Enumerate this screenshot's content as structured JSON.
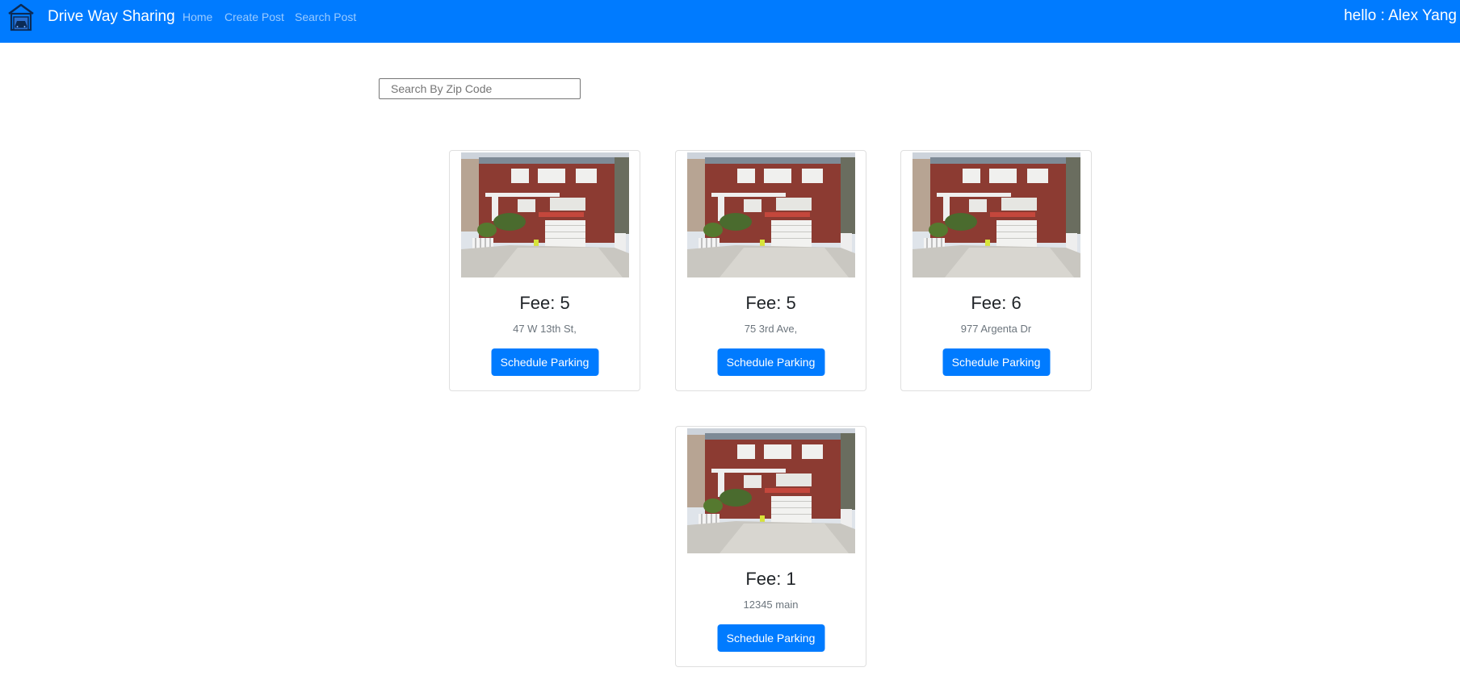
{
  "brand": {
    "title": "Drive Way Sharing",
    "logo_icon": "garage-house-icon"
  },
  "nav": {
    "home": "Home",
    "create_post": "Create Post",
    "search_post": "Search Post"
  },
  "user": {
    "greeting": "hello : Alex Yang"
  },
  "search": {
    "placeholder": "Search By Zip Code",
    "value": ""
  },
  "colors": {
    "primary": "#007bff",
    "navbar": "#007bff",
    "muted_text": "#6c757d"
  },
  "posts": [
    {
      "fee": "Fee: 5",
      "address": "47 W 13th St,",
      "button": "Schedule Parking"
    },
    {
      "fee": "Fee: 5",
      "address": "75 3rd Ave,",
      "button": "Schedule Parking"
    },
    {
      "fee": "Fee: 6",
      "address": "977 Argenta Dr",
      "button": "Schedule Parking"
    },
    {
      "fee": "Fee: 1",
      "address": "12345 main",
      "button": "Schedule Parking"
    }
  ]
}
